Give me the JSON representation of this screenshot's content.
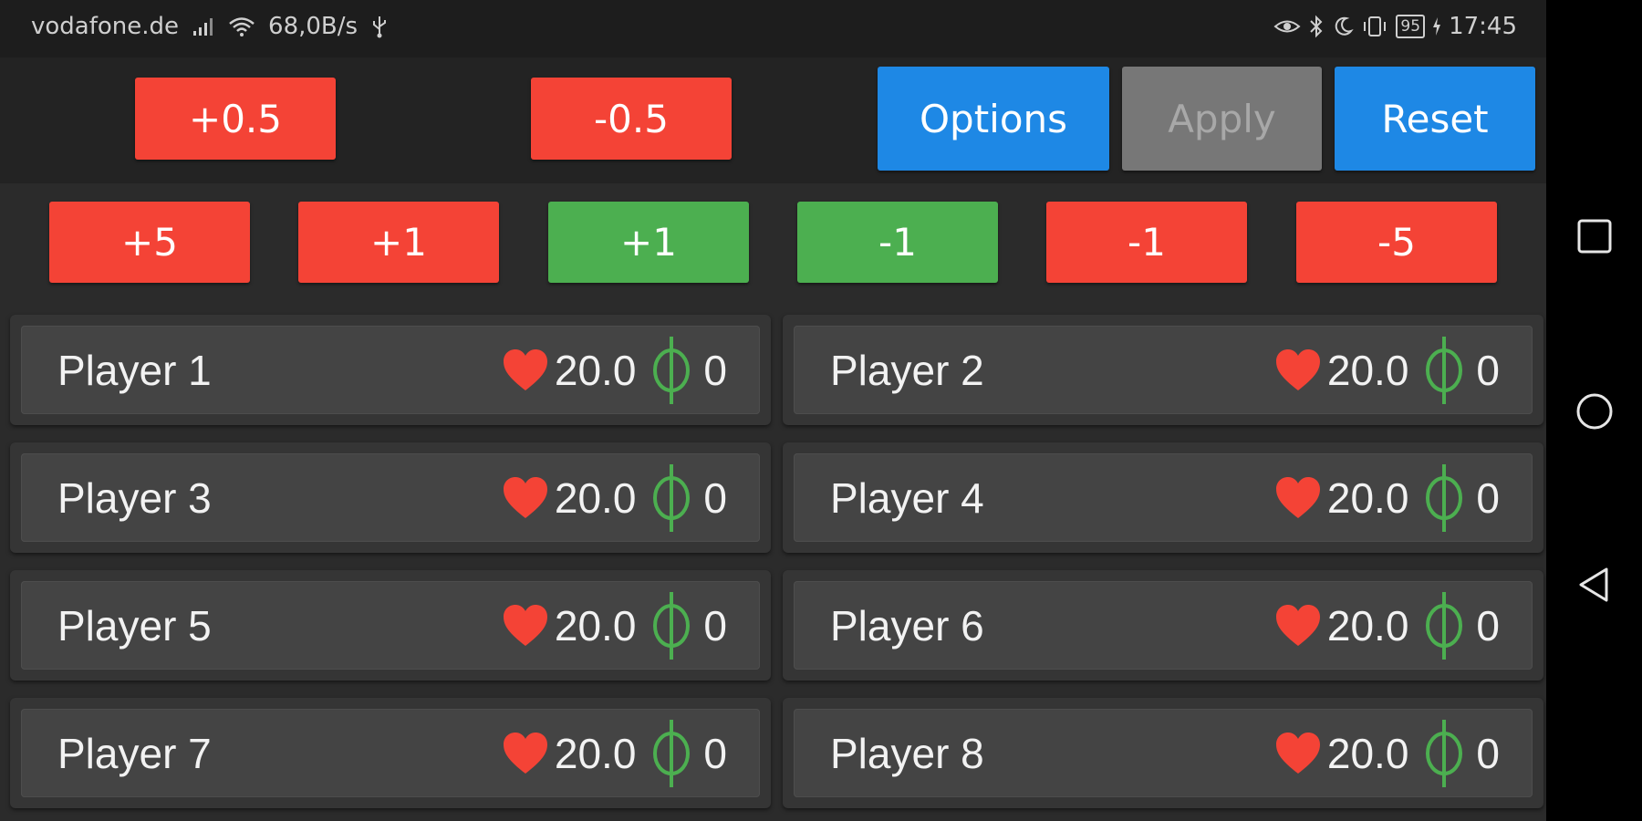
{
  "status_bar": {
    "carrier": "vodafone.de",
    "speed": "68,0B/s",
    "battery": "95",
    "time": "17:45",
    "icons": [
      "signal-icon",
      "wifi-icon",
      "usb-icon",
      "eye-icon",
      "bluetooth-icon",
      "moon-icon",
      "vibrate-icon",
      "battery-icon",
      "charging-icon"
    ]
  },
  "toolbar": {
    "plus_half": "+0.5",
    "minus_half": "-0.5",
    "options": "Options",
    "apply": "Apply",
    "reset": "Reset"
  },
  "steps": {
    "plus_five": "+5",
    "plus_one_red": "+1",
    "plus_one_green": "+1",
    "minus_one_green": "-1",
    "minus_one_red": "-1",
    "minus_five": "-5"
  },
  "players": [
    {
      "name": "Player 1",
      "life": "20.0",
      "poison": "0"
    },
    {
      "name": "Player 2",
      "life": "20.0",
      "poison": "0"
    },
    {
      "name": "Player 3",
      "life": "20.0",
      "poison": "0"
    },
    {
      "name": "Player 4",
      "life": "20.0",
      "poison": "0"
    },
    {
      "name": "Player 5",
      "life": "20.0",
      "poison": "0"
    },
    {
      "name": "Player 6",
      "life": "20.0",
      "poison": "0"
    },
    {
      "name": "Player 7",
      "life": "20.0",
      "poison": "0"
    },
    {
      "name": "Player 8",
      "life": "20.0",
      "poison": "0"
    }
  ],
  "colors": {
    "red": "#f44336",
    "green": "#4caf50",
    "blue": "#1e88e5",
    "disabled": "#777777",
    "heart": "#f44336",
    "poison": "#4caf50"
  },
  "nav_bar": {
    "icons": [
      "recents-square-icon",
      "home-circle-icon",
      "back-triangle-icon"
    ]
  }
}
